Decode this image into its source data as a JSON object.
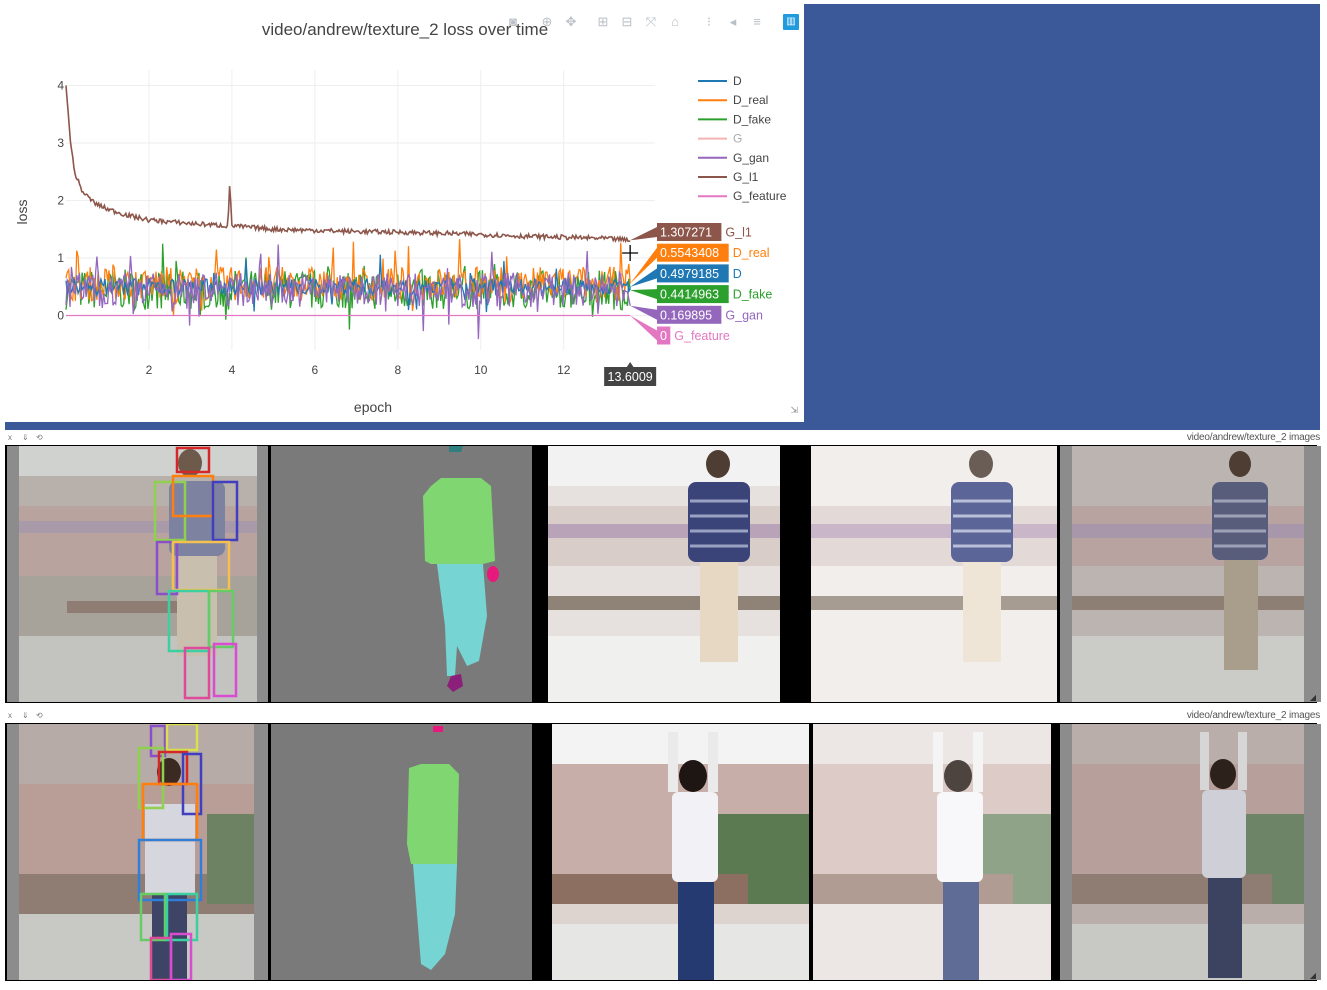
{
  "plot_window": {
    "toolbar_icons": [
      "camera-icon",
      "zoom-icon",
      "pan-icon",
      "zoom-in-icon",
      "zoom-out-icon",
      "autoscale-icon",
      "reset-axes-icon",
      "spike-lines-icon",
      "hover-closest-icon",
      "hover-compare-icon",
      "plotly-logo-icon"
    ],
    "hover_x_label": "13.6009",
    "cursor": "crosshair"
  },
  "chart_data": {
    "type": "line",
    "title": "video/andrew/texture_2 loss over time",
    "xlabel": "epoch",
    "ylabel": "loss",
    "xlim": [
      0,
      14.2
    ],
    "ylim": [
      -0.6,
      4.2
    ],
    "xticks": [
      2,
      4,
      6,
      8,
      10,
      12
    ],
    "yticks": [
      0,
      1,
      2,
      3,
      4
    ],
    "grid": true,
    "legend_position": "top-right",
    "series": [
      {
        "name": "D",
        "color": "#1f77b4",
        "mean": 0.5,
        "amp": 0.15,
        "last": 0.4979185,
        "label": "0.4979185"
      },
      {
        "name": "D_real",
        "color": "#ff7f0e",
        "mean": 0.55,
        "amp": 0.3,
        "last": 0.5543408,
        "label": "0.5543408"
      },
      {
        "name": "D_fake",
        "color": "#2ca02c",
        "mean": 0.45,
        "amp": 0.35,
        "last": 0.4414963,
        "label": "0.4414963"
      },
      {
        "name": "G",
        "color": "#f08080",
        "mean": 0.0,
        "amp": 0.0,
        "last": null,
        "label": null,
        "hidden": true
      },
      {
        "name": "G_gan",
        "color": "#9467bd",
        "mean": 0.45,
        "amp": 0.3,
        "last": 0.169895,
        "label": "0.169895"
      },
      {
        "name": "G_l1",
        "color": "#8c564b",
        "mean": 1.4,
        "amp": 0.05,
        "last": 1.307271,
        "label": "1.307271",
        "points": [
          [
            0,
            4.0
          ],
          [
            0.1,
            3.1
          ],
          [
            0.2,
            2.5
          ],
          [
            0.4,
            2.15
          ],
          [
            0.7,
            1.95
          ],
          [
            1,
            1.85
          ],
          [
            1.5,
            1.74
          ],
          [
            2,
            1.66
          ],
          [
            3,
            1.6
          ],
          [
            3.9,
            1.56
          ],
          [
            3.95,
            2.3
          ],
          [
            4,
            1.56
          ],
          [
            5,
            1.5
          ],
          [
            6,
            1.48
          ],
          [
            7,
            1.46
          ],
          [
            8,
            1.45
          ],
          [
            9,
            1.43
          ],
          [
            10,
            1.41
          ],
          [
            11,
            1.38
          ],
          [
            12,
            1.36
          ],
          [
            13,
            1.34
          ],
          [
            13.6,
            1.31
          ]
        ]
      },
      {
        "name": "G_feature",
        "color": "#e377c2",
        "mean": 0.0,
        "amp": 0.0,
        "last": 0,
        "label": "0"
      }
    ]
  },
  "image_windows": [
    {
      "title": "video/andrew/texture_2 images",
      "controls": [
        "x",
        "⇓",
        "⟲"
      ],
      "subject": "andrew"
    },
    {
      "title": "video/andrew/texture_2 images",
      "controls": [
        "x",
        "⇓",
        "⟲"
      ],
      "subject": "texture"
    }
  ],
  "colors": {
    "pane_background": "#3b5998",
    "segmentation_grey": "#7a7a7a"
  }
}
